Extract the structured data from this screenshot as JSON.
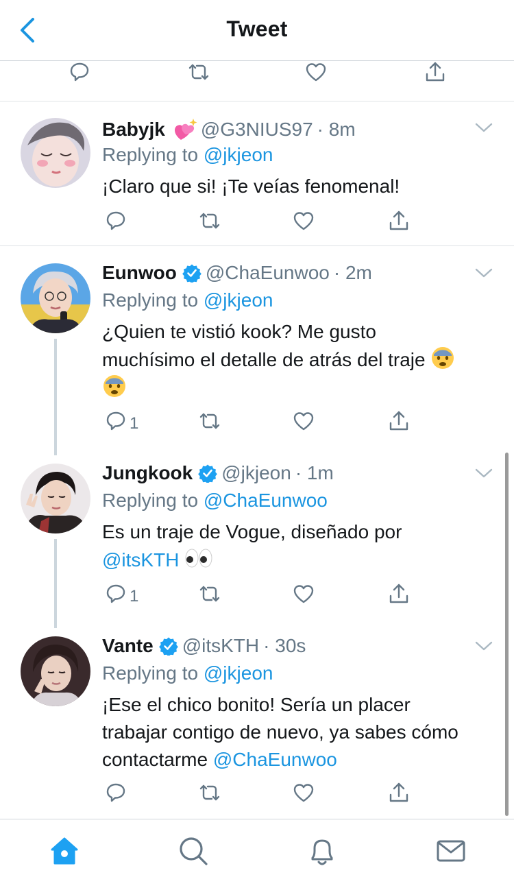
{
  "header": {
    "title": "Tweet",
    "back_icon": "chevron-left-icon"
  },
  "accent": "#1b95e0",
  "tweets": [
    {
      "name": "Babyjk",
      "name_emoji": "sparkling-heart-icon",
      "handle": "@G3NIUS97",
      "time": "· 8m",
      "replying_prefix": "Replying to",
      "replying_to": "@jkjeon",
      "text": "¡Claro que si! ¡Te veías fenomenal!",
      "verified": false
    },
    {
      "name": "Eunwoo",
      "handle": "@ChaEunwoo",
      "time": "· 2m",
      "replying_prefix": "Replying to",
      "replying_to": "@jkjeon",
      "text_line1": "¿Quien te vistió kook? Me gusto",
      "text_line2": "muchísimo el detalle de atrás del traje",
      "reply_count": "1",
      "verified": true
    },
    {
      "name": "Jungkook",
      "handle": "@jkjeon",
      "time": "· 1m",
      "replying_prefix": "Replying to",
      "replying_to": "@ChaEunwoo",
      "text_line1": "Es un traje de Vogue, diseñado por",
      "text_mention": "@itsKTH",
      "reply_count": "1",
      "verified": true
    },
    {
      "name": "Vante",
      "handle": "@itsKTH",
      "time": "· 30s",
      "replying_prefix": "Replying to",
      "replying_to": "@jkjeon",
      "text_line1": "¡Ese el chico bonito! Sería un placer",
      "text_line2": "trabajar contigo de nuevo, ya sabes cómo",
      "text_line3": "contactarme",
      "text_mention": "@ChaEunwoo",
      "verified": true
    }
  ],
  "tabbar": [
    "home-icon",
    "search-icon",
    "notifications-icon",
    "messages-icon"
  ]
}
